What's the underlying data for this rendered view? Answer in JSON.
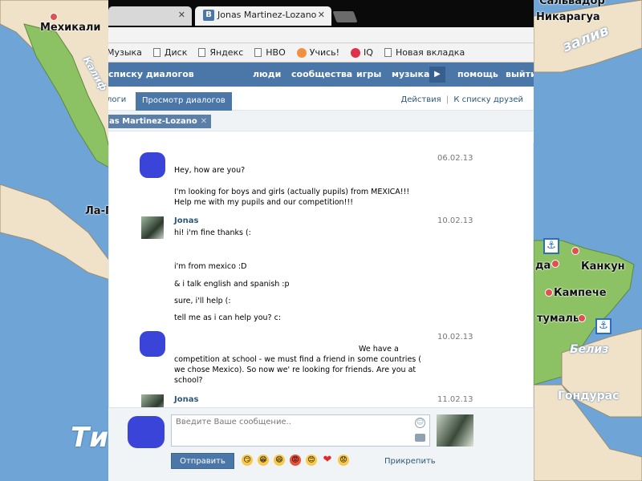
{
  "map": {
    "labels": [
      "Мехикали",
      "Никарагуа",
      "Сальвадор",
      "Ла-П",
      "Канкун",
      "Кампече",
      "тумаль",
      "да",
      "Белиз",
      "Гондурас",
      "Ти"
    ],
    "water_labels": [
      "залив",
      "Калиф"
    ]
  },
  "browser": {
    "tabs": [
      {
        "title": ""
      },
      {
        "title": "Jonas Martinez-Lozano",
        "icon": "vk-icon"
      }
    ],
    "bookmarks": [
      "Музыка",
      "Диск",
      "Яндекс",
      "НВО",
      "Учись!",
      "IQ",
      "Новая вкладка"
    ]
  },
  "vk": {
    "back_link": "списку диалогов",
    "nav": [
      "люди",
      "сообщества",
      "игры",
      "музыка",
      "помощь",
      "выйти"
    ],
    "subtabs": {
      "dialogs": "логи",
      "view": "Просмотр диалогов",
      "actions": "Действия",
      "separator": "|",
      "friends": "К списку друзей"
    },
    "chip": "as Martinez-Lozano"
  },
  "messages": [
    {
      "name": "",
      "date": "06.02.13",
      "lines": [
        "Hey, how are you?",
        "I'm looking for boys and girls (actually pupils) from MEXICA!!! Help me with my pupils and our competition!!!"
      ]
    },
    {
      "name": "Jonas",
      "date": "10.02.13",
      "lines": [
        "hi! i'm fine thanks (:",
        "i'm from mexico :D",
        "& i talk english and spanish :p",
        "sure, i'll help (:",
        "tell me as i can help you? c:"
      ]
    },
    {
      "name": "",
      "date": "10.02.13",
      "lines": [
        "We have a competition at school - we must find a friend in some countries ( we chose Mexico). So now we' re looking for friends. Are you at school?"
      ]
    },
    {
      "name": "Jonas",
      "date": "11.02.13",
      "lines": []
    }
  ],
  "compose": {
    "placeholder": "Введите Ваше сообщение..",
    "send": "Отправить",
    "attach": "Прикрепить",
    "emojis": [
      "😏",
      "😁",
      "😄",
      "😡",
      "😊",
      "❤",
      "😟"
    ]
  }
}
